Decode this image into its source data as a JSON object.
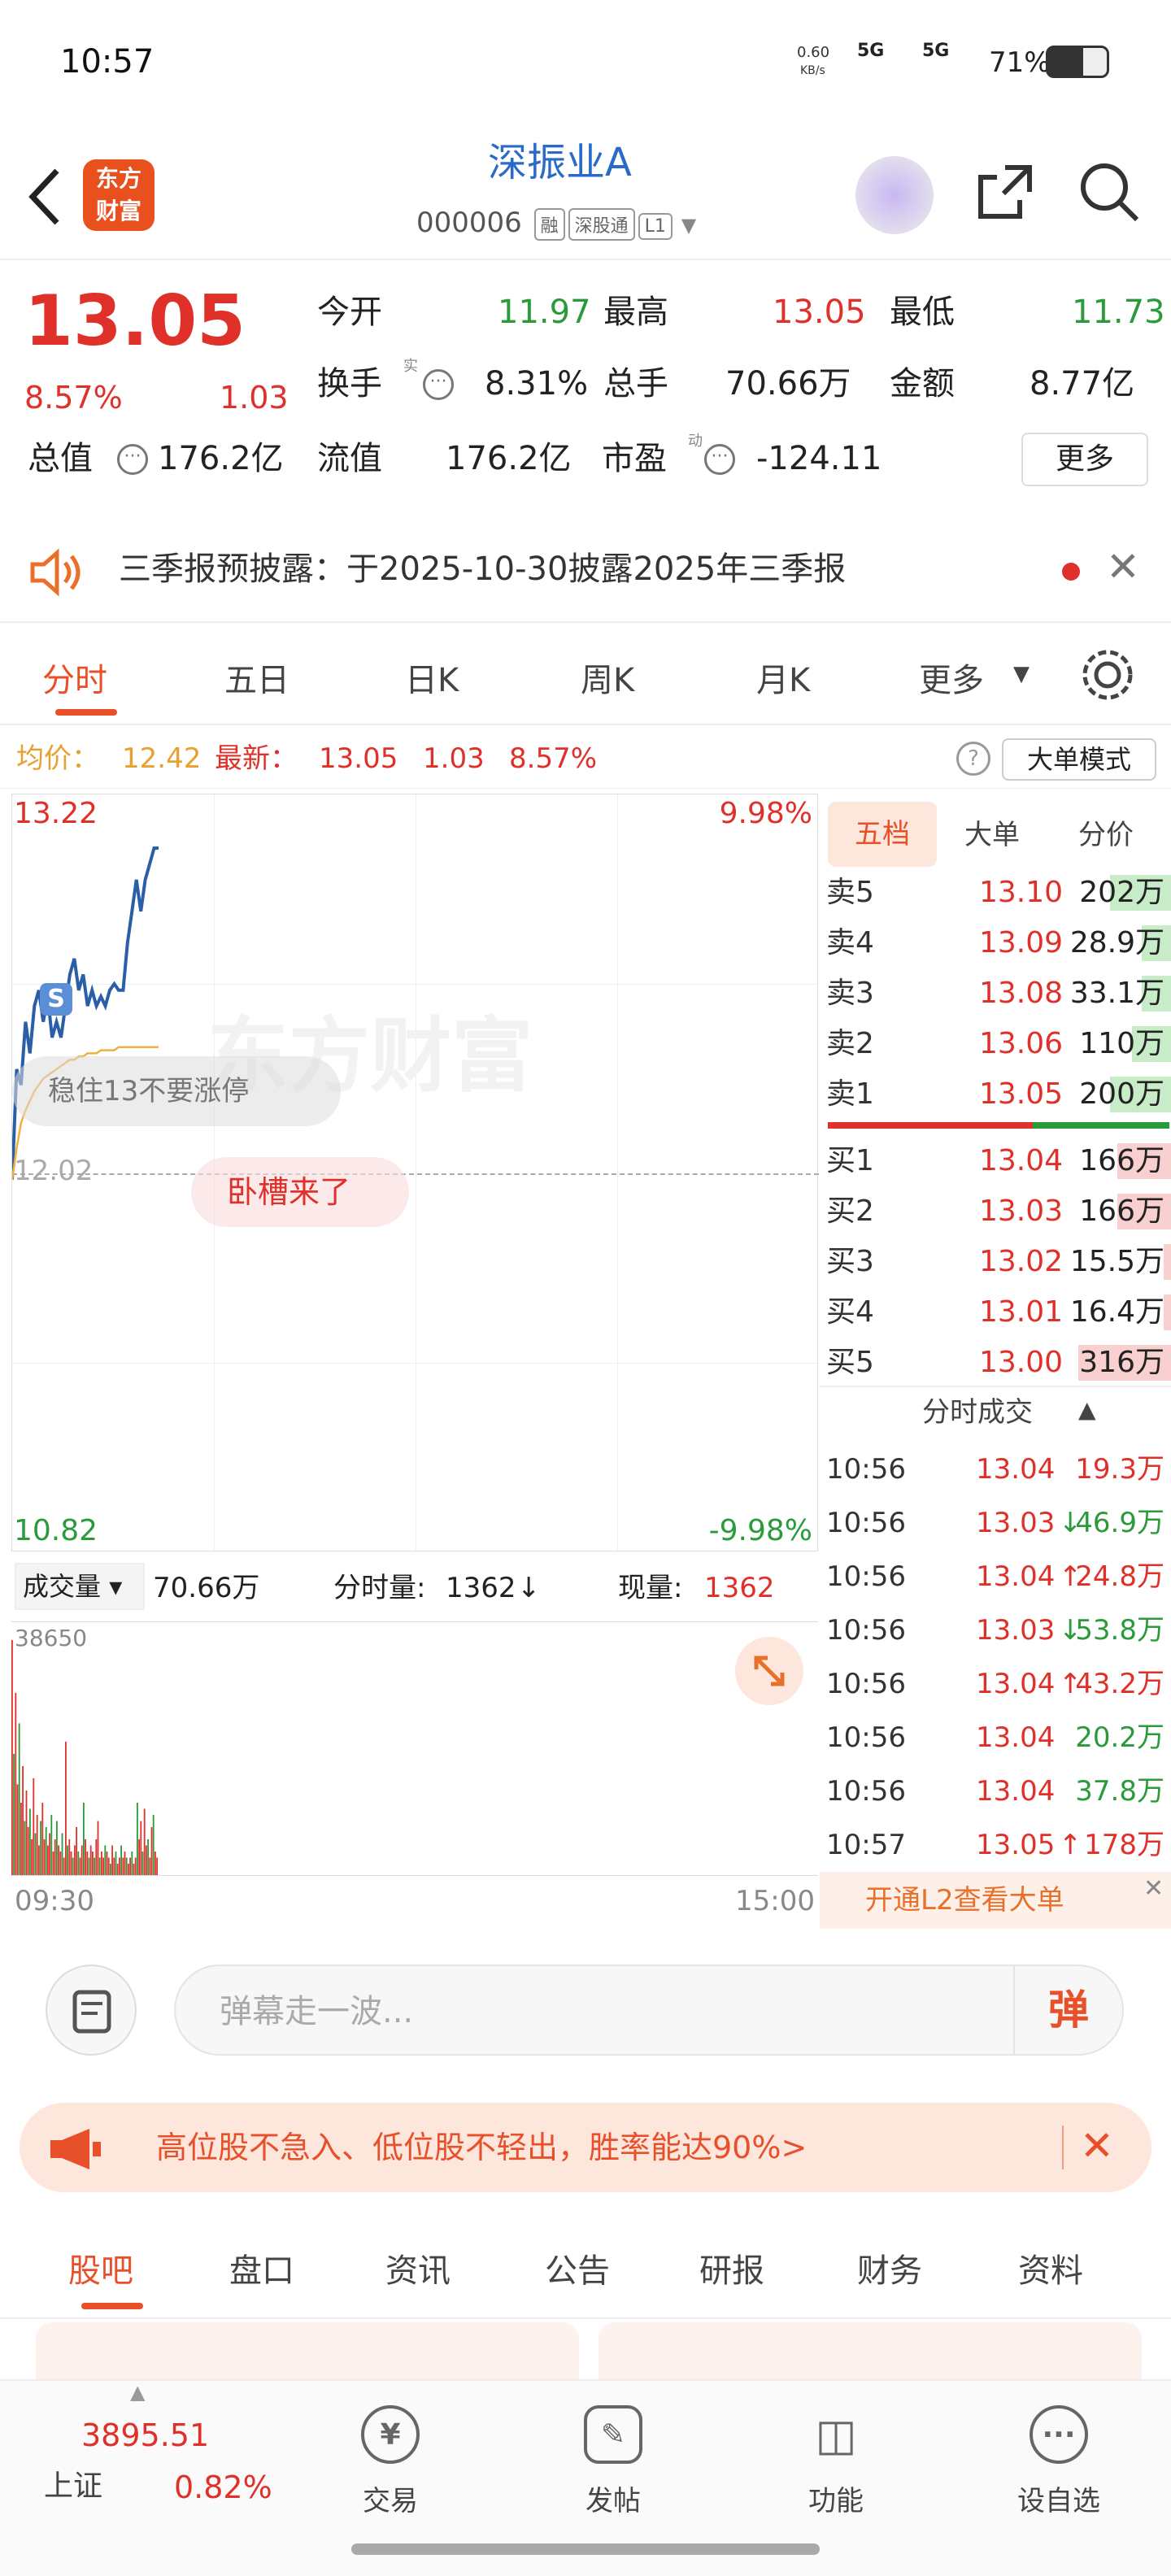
{
  "status_bar": {
    "time": "10:57",
    "net_speed": "0.60",
    "net_unit": "KB/s",
    "signal1": "5G",
    "signal2": "5G",
    "battery": "71%"
  },
  "header": {
    "logo_line1": "东方",
    "logo_line2": "财富",
    "title": "深振业A",
    "code": "000006",
    "tag1": "融",
    "tag2": "深股通",
    "tag3": "L1"
  },
  "quote": {
    "price": "13.05",
    "pct": "8.57%",
    "chg": "1.03",
    "open_label": "今开",
    "open": "11.97",
    "high_label": "最高",
    "high": "13.05",
    "low_label": "最低",
    "low": "11.73",
    "turnover_label": "换手",
    "turnover_sup": "实",
    "turnover": "8.31%",
    "vol_label": "总手",
    "vol": "70.66万",
    "amount_label": "金额",
    "amount": "8.77亿",
    "mcap_label": "总值",
    "mcap": "176.2亿",
    "float_label": "流值",
    "float": "176.2亿",
    "pe_label": "市盈",
    "pe_sup": "动",
    "pe": "-124.11",
    "more": "更多"
  },
  "announcement": {
    "text": "三季报预披露：于2025-10-30披露2025年三季报"
  },
  "chart_tabs": [
    "分时",
    "五日",
    "日K",
    "周K",
    "月K",
    "更多"
  ],
  "intraday_info": {
    "avg_label": "均价：",
    "avg": "12.42",
    "latest_label": "最新：",
    "latest": "13.05",
    "chg": "1.03",
    "pct": "8.57%",
    "mode_button": "大单模式"
  },
  "chart_data": {
    "type": "line",
    "x_start": "09:30",
    "x_end": "15:00",
    "y_max": "13.22",
    "y_min": "10.82",
    "pct_max": "9.98%",
    "pct_min": "-9.98%",
    "prev_close": "12.02",
    "series": [
      {
        "values": [
          12.0,
          12.35,
          12.3,
          12.5,
          12.4,
          12.55,
          12.6,
          12.5,
          12.58,
          12.45,
          12.5,
          12.45,
          12.55,
          12.65,
          12.7,
          12.6,
          12.65,
          12.55,
          12.6,
          12.55,
          12.58,
          12.55,
          12.6,
          12.62,
          12.6,
          12.6,
          12.75,
          12.85,
          12.95,
          12.85,
          12.95,
          13.0,
          13.05,
          13.05
        ]
      },
      {
        "values": [
          12.0,
          12.1,
          12.18,
          12.22,
          12.25,
          12.28,
          12.3,
          12.32,
          12.33,
          12.34,
          12.35,
          12.36,
          12.37,
          12.38,
          12.38,
          12.39,
          12.39,
          12.4,
          12.4,
          12.4,
          12.41,
          12.41,
          12.41,
          12.41,
          12.42,
          12.42,
          12.42,
          12.42,
          12.42,
          12.42,
          12.42,
          12.42,
          12.42,
          12.42
        ]
      }
    ],
    "s_marker": "S",
    "danmu1": "稳住13不要涨停",
    "danmu2": "卧槽来了",
    "watermark": "东方财富"
  },
  "volume": {
    "selector": "成交量",
    "total": "70.66万",
    "min_label": "分时量:",
    "min_val": "1362",
    "now_label": "现量:",
    "now_val": "1362",
    "max": "38650",
    "bars": [
      38650,
      20000,
      30000,
      15000,
      25000,
      12000,
      18000,
      9000,
      14000,
      8000,
      11000,
      6000,
      16000,
      7000,
      10000,
      5000,
      9000,
      12000,
      6000,
      8000,
      5000,
      7000,
      10000,
      4000,
      6000,
      9000,
      5000,
      4000,
      7000,
      3000,
      22000,
      5000,
      6000,
      4000,
      3000,
      5000,
      8000,
      4000,
      3000,
      5000,
      12000,
      6000,
      4000,
      3000,
      5000,
      4000,
      3000,
      6000,
      9000,
      3000,
      4000,
      3000,
      5000,
      4000,
      3000,
      2000,
      5000,
      3000,
      4000,
      2000,
      3000,
      5000,
      3000,
      4000,
      3000,
      2000,
      3000,
      4000,
      2000,
      3000,
      12000,
      6000,
      9000,
      4000,
      11000,
      5000,
      6000,
      3000,
      8000,
      10000,
      4000,
      3000
    ]
  },
  "orderbook": {
    "tabs": [
      "五档",
      "大单",
      "分价"
    ],
    "asks": [
      {
        "label": "卖5",
        "price": "13.10",
        "vol": "202万",
        "w": 0.25
      },
      {
        "label": "卖4",
        "price": "13.09",
        "vol": "28.9万",
        "w": 0.12
      },
      {
        "label": "卖3",
        "price": "13.08",
        "vol": "33.1万",
        "w": 0.12
      },
      {
        "label": "卖2",
        "price": "13.06",
        "vol": "110万",
        "w": 0.16
      },
      {
        "label": "卖1",
        "price": "13.05",
        "vol": "200万",
        "w": 0.25
      }
    ],
    "bids": [
      {
        "label": "买1",
        "price": "13.04",
        "vol": "166万",
        "w": 0.22
      },
      {
        "label": "买2",
        "price": "13.03",
        "vol": "166万",
        "w": 0.22
      },
      {
        "label": "买3",
        "price": "13.02",
        "vol": "15.5万",
        "w": 0.03
      },
      {
        "label": "买4",
        "price": "13.01",
        "vol": "16.4万",
        "w": 0.03
      },
      {
        "label": "买5",
        "price": "13.00",
        "vol": "316万",
        "w": 0.38
      }
    ],
    "deals_header": "分时成交",
    "deals": [
      {
        "time": "10:56",
        "price": "13.04",
        "arrow": "",
        "vol": "19.3万",
        "c": "red"
      },
      {
        "time": "10:56",
        "price": "13.03",
        "arrow": "↓",
        "vol": "46.9万",
        "c": "green"
      },
      {
        "time": "10:56",
        "price": "13.04",
        "arrow": "↑",
        "vol": "24.8万",
        "c": "red"
      },
      {
        "time": "10:56",
        "price": "13.03",
        "arrow": "↓",
        "vol": "53.8万",
        "c": "green"
      },
      {
        "time": "10:56",
        "price": "13.04",
        "arrow": "↑",
        "vol": "43.2万",
        "c": "red"
      },
      {
        "time": "10:56",
        "price": "13.04",
        "arrow": "",
        "vol": "20.2万",
        "c": "green"
      },
      {
        "time": "10:56",
        "price": "13.04",
        "arrow": "",
        "vol": "37.8万",
        "c": "green"
      },
      {
        "time": "10:57",
        "price": "13.05",
        "arrow": "↑",
        "vol": "178万",
        "c": "red"
      }
    ],
    "l2_banner": "开通L2查看大单"
  },
  "comment": {
    "placeholder": "弹幕走一波...",
    "danmu_button": "弹"
  },
  "promo": {
    "text": "高位股不急入、低位股不轻出，胜率能达90%>"
  },
  "bottom_tabs": [
    "股吧",
    "盘口",
    "资讯",
    "公告",
    "研报",
    "财务",
    "资料"
  ],
  "nav": {
    "index_value": "3895.51",
    "index_name": "上证",
    "index_pct": "0.82%",
    "items": [
      "交易",
      "发帖",
      "功能",
      "设自选"
    ]
  }
}
